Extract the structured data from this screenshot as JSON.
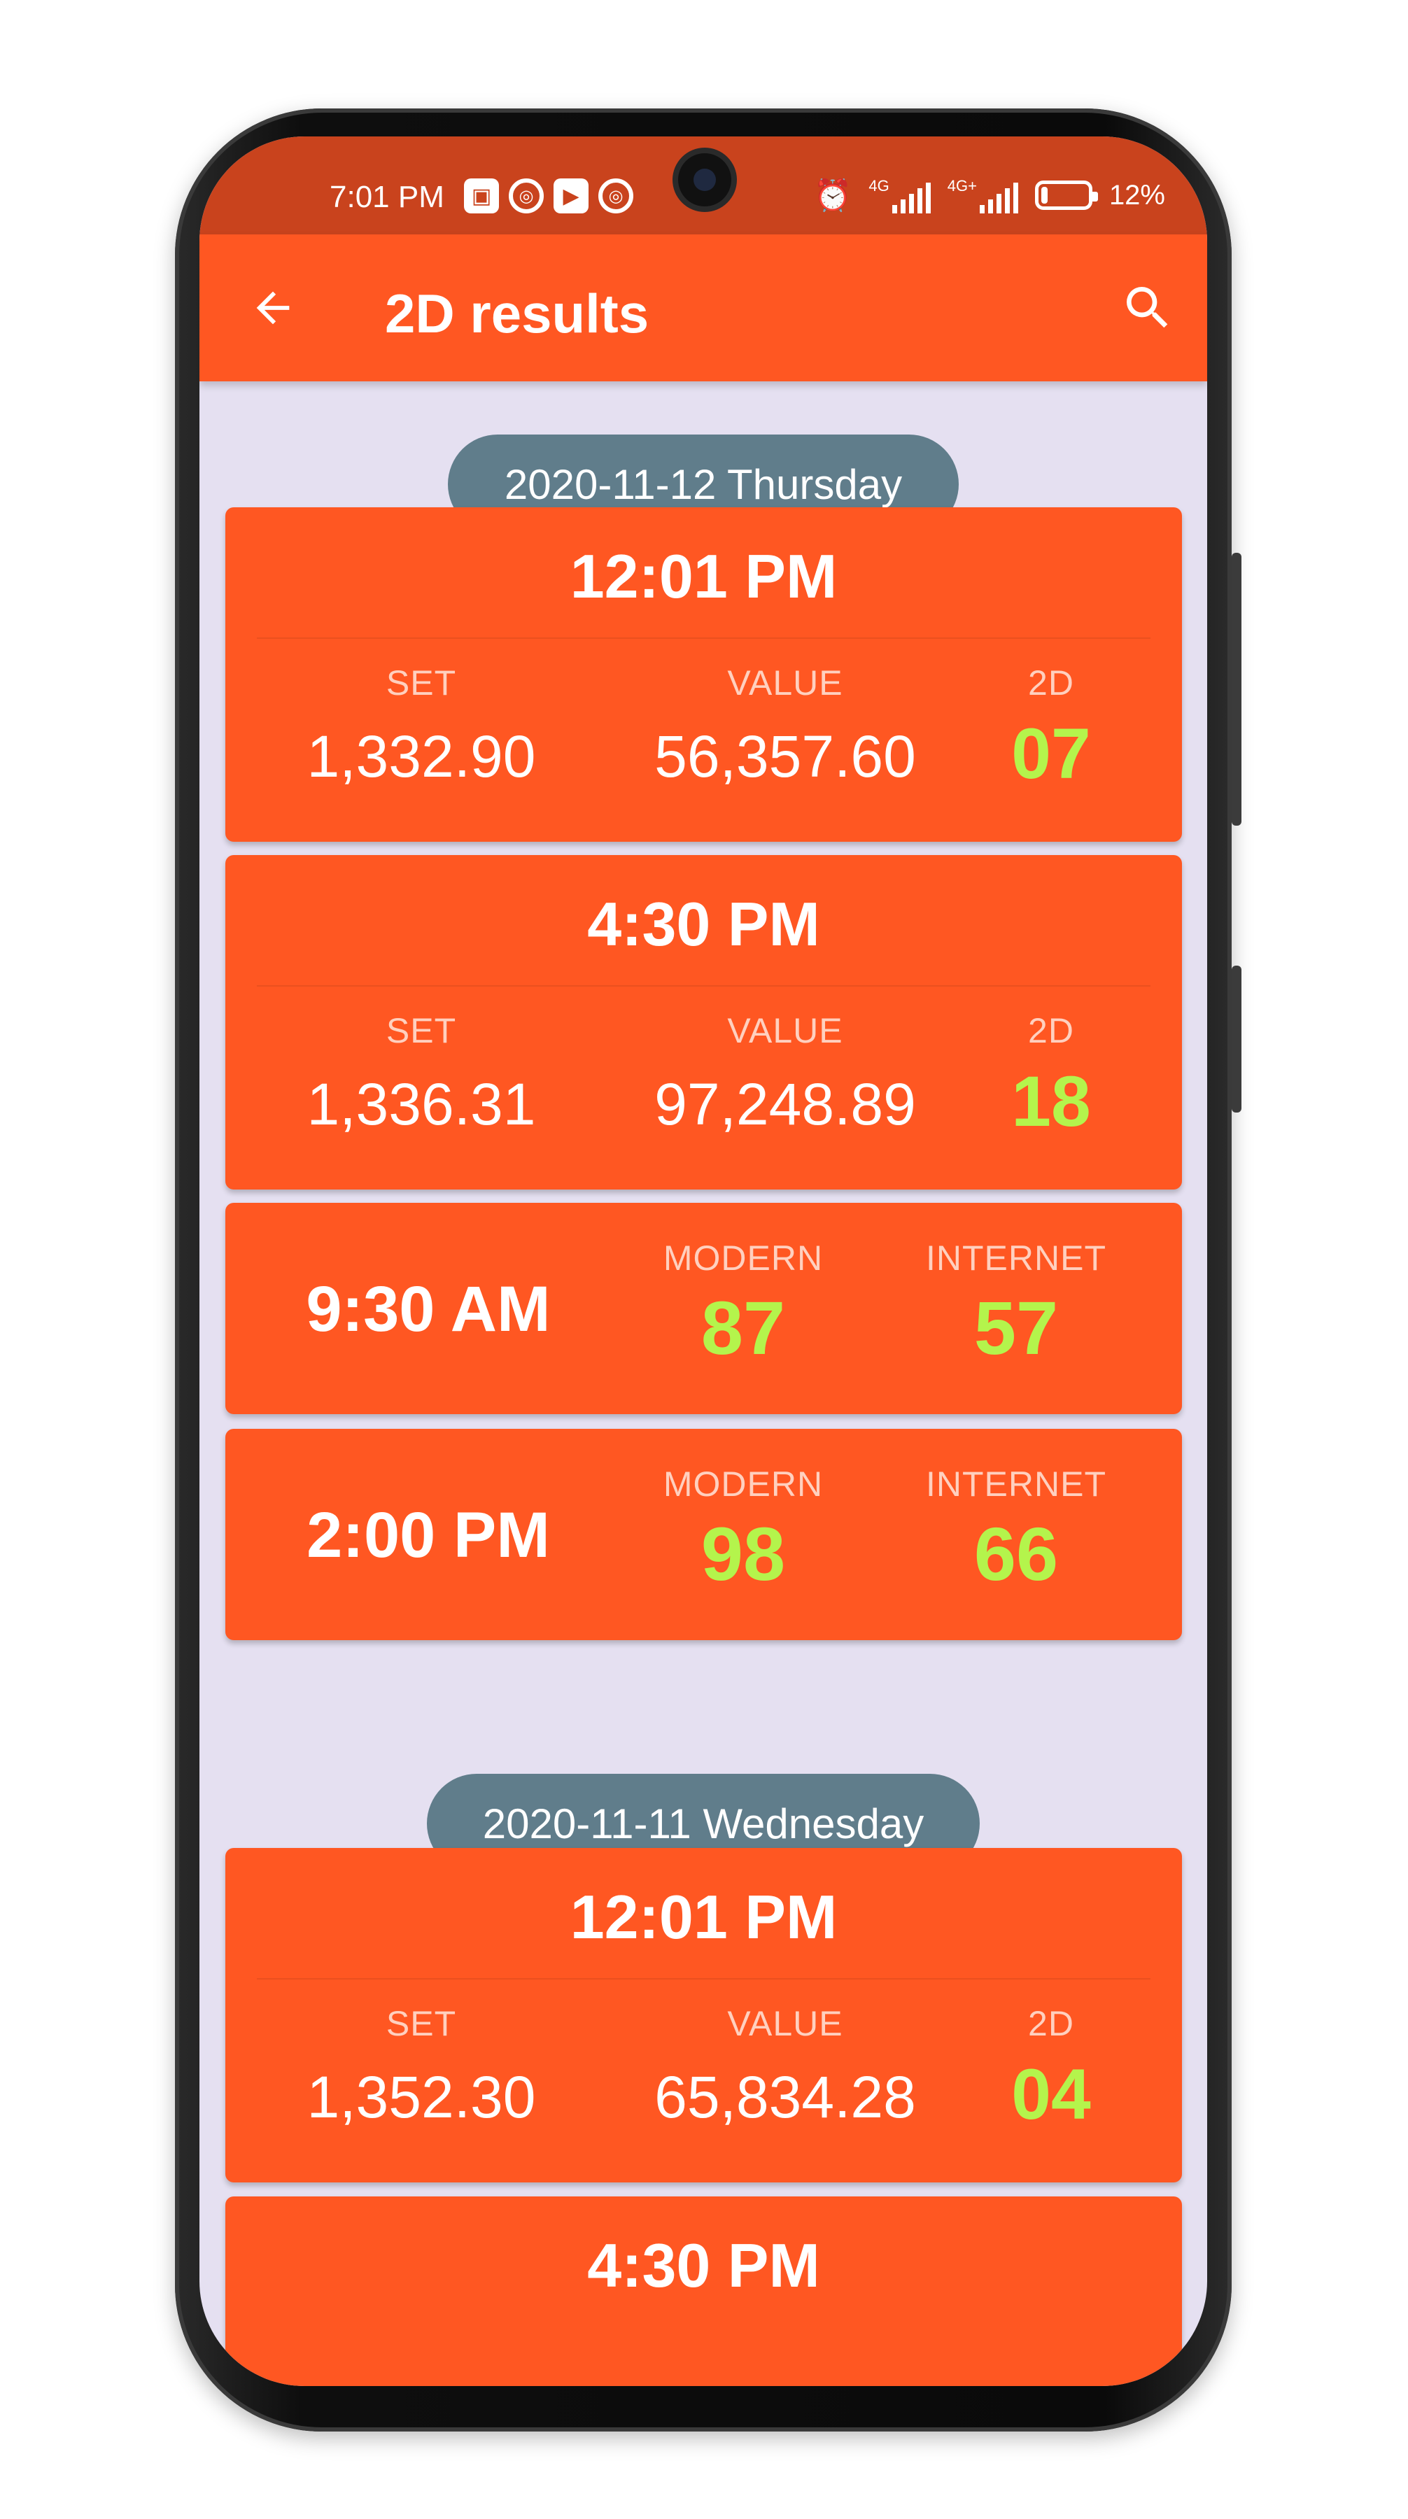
{
  "status_bar": {
    "time": "7:01 PM",
    "network_1": "4G",
    "network_2": "4G+",
    "battery": "12%"
  },
  "app_bar": {
    "title": "2D results",
    "back_icon": "arrow-left-icon",
    "search_icon": "search-icon"
  },
  "colors": {
    "primary": "#ff5722",
    "status_bar": "#c9431d",
    "chip": "#607d8b",
    "background": "#e5e0f1",
    "highlight_number": "#b4f44c"
  },
  "days": [
    {
      "date": "2020-11-12 Thursday",
      "draws": [
        {
          "time": "12:01 PM",
          "set_label": "SET",
          "set": "1,332.90",
          "value_label": "VALUE",
          "value": "56,357.60",
          "twod_label": "2D",
          "twod": "07"
        },
        {
          "time": "4:30 PM",
          "set_label": "SET",
          "set": "1,336.31",
          "value_label": "VALUE",
          "value": "97,248.89",
          "twod_label": "2D",
          "twod": "18"
        }
      ],
      "extras": [
        {
          "time": "9:30 AM",
          "modern_label": "MODERN",
          "modern": "87",
          "internet_label": "INTERNET",
          "internet": "57"
        },
        {
          "time": "2:00 PM",
          "modern_label": "MODERN",
          "modern": "98",
          "internet_label": "INTERNET",
          "internet": "66"
        }
      ]
    },
    {
      "date": "2020-11-11 Wednesday",
      "draws": [
        {
          "time": "12:01 PM",
          "set_label": "SET",
          "set": "1,352.30",
          "value_label": "VALUE",
          "value": "65,834.28",
          "twod_label": "2D",
          "twod": "04"
        },
        {
          "time": "4:30 PM"
        }
      ]
    }
  ]
}
